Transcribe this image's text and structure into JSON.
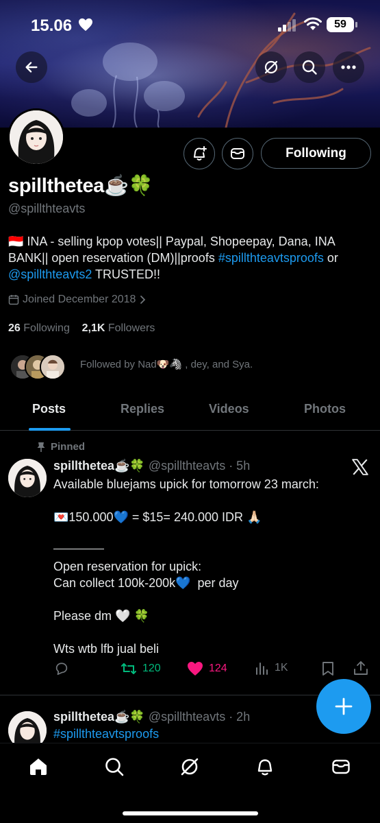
{
  "status_bar": {
    "time": "15.06",
    "battery": "59"
  },
  "profile": {
    "display_name": "spillthetea☕️🍀",
    "handle": "@spillthteavts",
    "bio_flag": "🇮🇩",
    "bio_text": " INA - selling kpop votes|| Paypal, Shopeepay, Dana, INA BANK|| open reservation (DM)||proofs ",
    "bio_link1": "#spillthteavtsproofs",
    "bio_mid": " or ",
    "bio_link2": "@spillthteavts2",
    "bio_end": " TRUSTED!!",
    "joined": "Joined December 2018",
    "following_count": "26",
    "following_label": "Following",
    "followers_count": "2,1K",
    "followers_label": "Followers",
    "followed_by": "Followed by Nad🐶🦓 , dey, and Sya.",
    "following_button": "Following"
  },
  "tabs": [
    "Posts",
    "Replies",
    "Videos",
    "Photos"
  ],
  "pinned_post": {
    "pinned_label": "Pinned",
    "name": "spillthetea☕️🍀",
    "meta": "@spillthteavts · 5h",
    "body": "Available bluejams upick for tomorrow 23 march:\n\n💌150.000💙 = $15= 240.000 IDR 🙏🏻\n\n\nOpen reservation for upick:\nCan collect 100k-200k💙  per day\n\nPlease dm 🤍 🍀\n\nWts wtb lfb jual beli",
    "retweets": "120",
    "likes": "124",
    "views": "1K"
  },
  "second_post": {
    "name": "spillthetea☕️🍀",
    "meta": "@spillthteavts · 2h",
    "body": "#spillthteavtsproofs"
  },
  "colors": {
    "accent": "#1d9bf0",
    "retweet": "#00ba7c",
    "like": "#f91880",
    "muted": "#71767b"
  }
}
